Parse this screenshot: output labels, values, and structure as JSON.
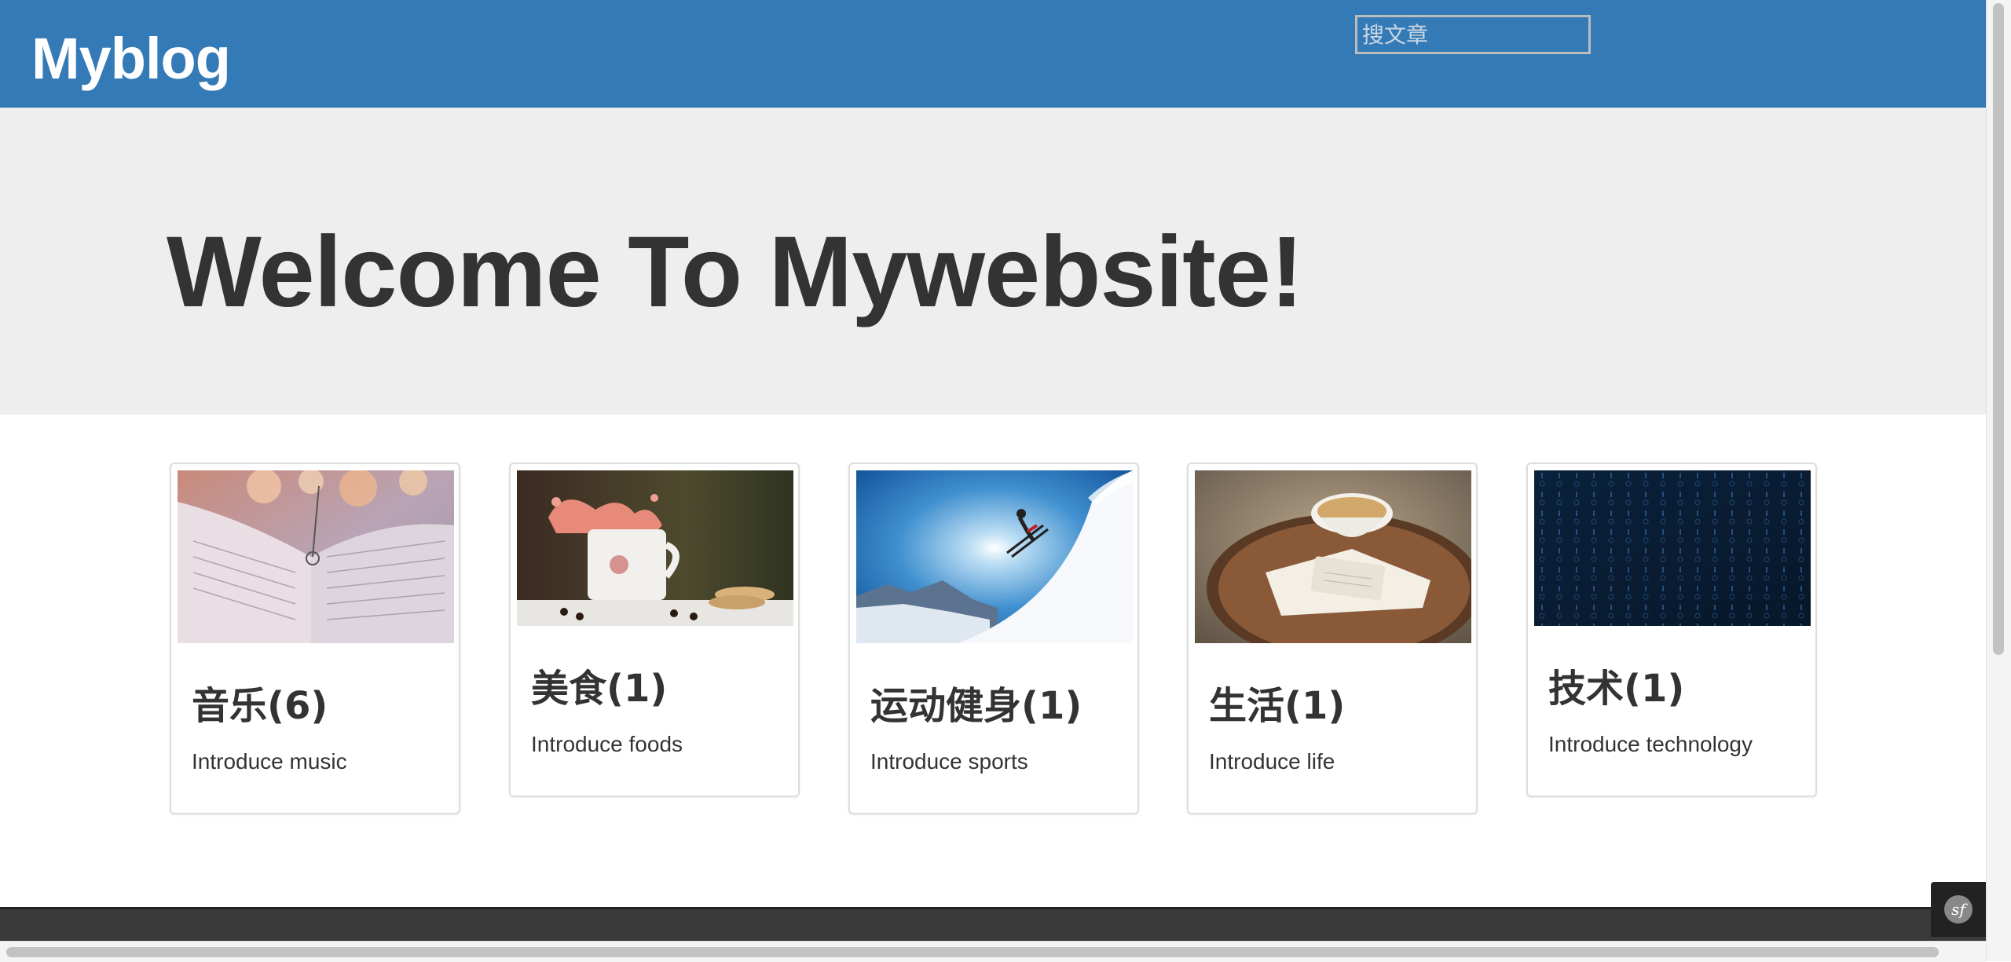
{
  "header": {
    "brand": "Myblog",
    "search_placeholder": "搜文章",
    "bg_color": "#337ab7"
  },
  "jumbotron": {
    "title": "Welcome To Mywebsite!"
  },
  "categories": [
    {
      "title": "音乐(6)",
      "description": "Introduce music",
      "image": "sheet-music-photo"
    },
    {
      "title": "美食(1)",
      "description": "Introduce foods",
      "image": "coffee-splash-photo"
    },
    {
      "title": "运动健身(1)",
      "description": "Introduce sports",
      "image": "skier-photo"
    },
    {
      "title": "生活(1)",
      "description": "Introduce life",
      "image": "tea-tray-photo"
    },
    {
      "title": "技术(1)",
      "description": "Introduce technology",
      "image": "binary-code-photo"
    }
  ],
  "toolbar": {
    "icon": "symfony-icon"
  }
}
